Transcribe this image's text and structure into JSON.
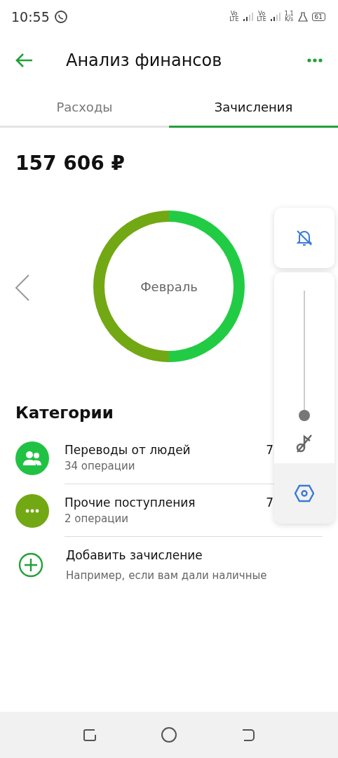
{
  "status_bar": {
    "time": "10:55",
    "sim_1": "Vo\nLTE",
    "sim_2": "Vo\nLTE",
    "speed": "1,1\nK/s",
    "battery": "61"
  },
  "header": {
    "title": "Анализ финансов"
  },
  "tabs": [
    {
      "label": "Расходы",
      "selected": false
    },
    {
      "label": "Зачисления",
      "selected": true
    }
  ],
  "total": "157 606 ₽",
  "chart": {
    "month": "Февраль"
  },
  "categories": {
    "title": "Категории",
    "items": [
      {
        "kind": "people",
        "name": "Переводы от людей",
        "count": "34 операции",
        "amount": "7",
        "color": "#21c244"
      },
      {
        "kind": "other",
        "name": "Прочие поступления",
        "count": "2 операции",
        "amount": "7",
        "color": "#72a814"
      }
    ]
  },
  "add": {
    "title": "Добавить зачисление",
    "hint": "Например, если вам дали наличные"
  },
  "volume_panel": {
    "level": 0
  }
}
